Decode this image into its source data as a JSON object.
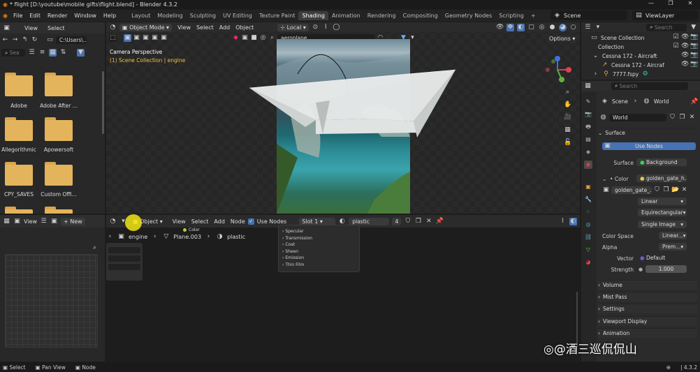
{
  "window": {
    "title": "* flight [D:\\youtube\\mobile gifts\\flight.blend] - Blender 4.3.2",
    "controls": [
      "—",
      "❐",
      "✕"
    ]
  },
  "menu": [
    "File",
    "Edit",
    "Render",
    "Window",
    "Help"
  ],
  "workspaces": [
    "Layout",
    "Modeling",
    "Sculpting",
    "UV Editing",
    "Texture Paint",
    "Shading",
    "Animation",
    "Rendering",
    "Compositing",
    "Geometry Nodes",
    "Scripting",
    "+"
  ],
  "topright": {
    "scene": "Scene",
    "view_layer": "ViewLayer"
  },
  "file_browser": {
    "menu": [
      "View",
      "Select"
    ],
    "path": "C:\\Users\\...",
    "search_placeholder": "Sea",
    "folders": [
      "Adobe",
      "Adobe After ...",
      "Allegorithmic",
      "Apowersoft",
      "CPY_SAVES",
      "Custom Offi..."
    ]
  },
  "viewport": {
    "mode": "Object Mode",
    "menu": [
      "View",
      "Select",
      "Add",
      "Object"
    ],
    "transform": "Local",
    "search_value": "aeroplane",
    "options": "Options",
    "overlay_title": "Camera Perspective",
    "overlay_sub": "(1) Scene Collection | engine"
  },
  "image_editor": {
    "menu": [
      "View"
    ],
    "new_label": "New"
  },
  "node_editor": {
    "object_label": "Object",
    "menu": [
      "View",
      "Select",
      "Add",
      "Node"
    ],
    "use_nodes": "Use Nodes",
    "slot": "Slot 1",
    "material": "plastic",
    "users": "4",
    "breadcrumb": [
      "engine",
      "Plane.003",
      "plastic"
    ],
    "node_socket": "Color",
    "popup_items": [
      "Specular",
      "Transmission",
      "Coat",
      "Sheen",
      "Emission",
      "Thin Film"
    ]
  },
  "outliner": {
    "search_placeholder": "Search",
    "rows": [
      {
        "label": "Scene Collection",
        "indent": 0
      },
      {
        "label": "Collection",
        "indent": 1
      },
      {
        "label": "Cessna 172 - Aircraft",
        "indent": 1
      },
      {
        "label": "Cessna 172 - Aircraf",
        "indent": 2
      },
      {
        "label": "7777.fspy",
        "indent": 1
      }
    ]
  },
  "properties": {
    "search_placeholder": "Search",
    "breadcrumb": [
      "Scene",
      "World"
    ],
    "world_name": "World",
    "surface_section": "Surface",
    "use_nodes": "Use Nodes",
    "surface_label": "Surface",
    "surface_value": "Background",
    "color_label": "Color",
    "color_value": "golden_gate_h...",
    "image_name": "golden_gate_...",
    "interpolation": "Linear",
    "projection": "Equirectangular",
    "source": "Single Image",
    "colorspace_label": "Color Space",
    "colorspace_value": "Linear...",
    "alpha_label": "Alpha",
    "alpha_value": "Prem...",
    "vector_label": "Vector",
    "vector_value": "Default",
    "strength_label": "Strength",
    "strength_value": "1.000",
    "sections": [
      "Volume",
      "Mist Pass",
      "Settings",
      "Viewport Display",
      "Animation"
    ]
  },
  "statusbar": {
    "items": [
      "Select",
      "Pan View",
      "Node"
    ],
    "version": "4.3.2"
  },
  "watermark": "@酒三巡侃侃山",
  "colors": {
    "accent": "#4772b3",
    "folder": "#e4b45c",
    "header": "#2e2e2e",
    "bg": "#1d1d1d"
  }
}
